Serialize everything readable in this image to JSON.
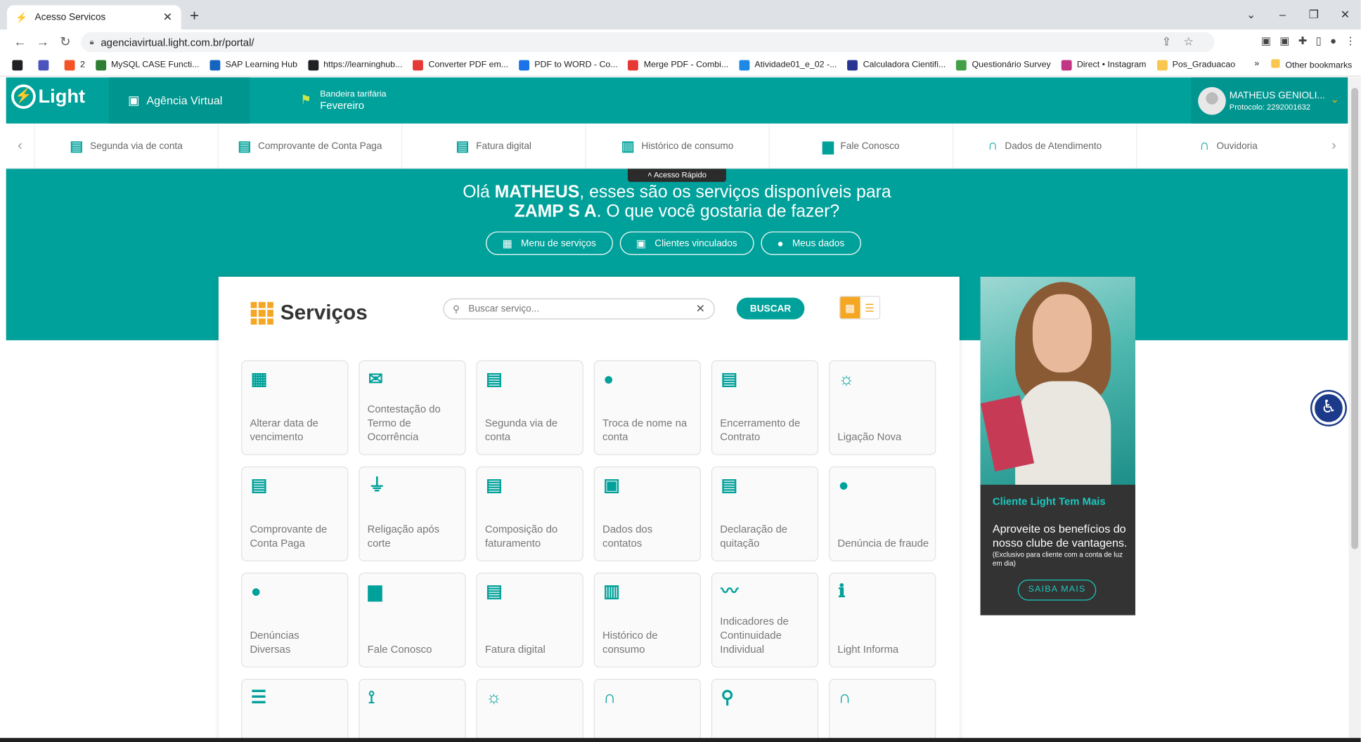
{
  "browser": {
    "tab_title": "Acesso Servicos",
    "url": "agenciavirtual.light.com.br/portal/",
    "bookmarks": [
      {
        "label": "",
        "color": "#202124"
      },
      {
        "label": "",
        "color": "#4b53bc"
      },
      {
        "label": "2",
        "color": "#f35325"
      },
      {
        "label": "MySQL CASE Functi...",
        "color": "#2e7d32"
      },
      {
        "label": "SAP Learning Hub",
        "color": "#1565c0"
      },
      {
        "label": "https://learninghub...",
        "color": "#202124"
      },
      {
        "label": "Converter PDF em...",
        "color": "#e53935"
      },
      {
        "label": "PDF to WORD - Co...",
        "color": "#1a73e8"
      },
      {
        "label": "Merge PDF - Combi...",
        "color": "#e53935"
      },
      {
        "label": "Atividade01_e_02 -...",
        "color": "#1e88e5"
      },
      {
        "label": "Calculadora Cientifi...",
        "color": "#283593"
      },
      {
        "label": "Questionário Survey",
        "color": "#43a047"
      },
      {
        "label": "Direct • Instagram",
        "color": "#c13584"
      },
      {
        "label": "Pos_Graduacao",
        "color": "#f9c74f"
      }
    ],
    "more_bookmarks": "»",
    "other_bookmarks": "Other bookmarks"
  },
  "header": {
    "logo": "Light",
    "agencia": "Agência Virtual",
    "bandeira_label": "Bandeira tarifária",
    "bandeira_value": "Fevereiro",
    "user_name": "MATHEUS GENIOLI...",
    "user_protocol": "Protocolo: 2292001632"
  },
  "quick": {
    "items": [
      {
        "icon": "bill-icon",
        "glyph": "▤",
        "label": "Segunda via de conta"
      },
      {
        "icon": "receipt-icon",
        "glyph": "▤",
        "label": "Comprovante de Conta Paga"
      },
      {
        "icon": "digital-bill-icon",
        "glyph": "▤",
        "label": "Fatura digital"
      },
      {
        "icon": "chart-icon",
        "glyph": "▥",
        "label": "Histórico de consumo"
      },
      {
        "icon": "chat-icon",
        "glyph": "▆",
        "label": "Fale Conosco"
      },
      {
        "icon": "headset-icon",
        "glyph": "∩",
        "label": "Dados de Atendimento"
      },
      {
        "icon": "headset-icon",
        "glyph": "∩",
        "label": "Ouvidoria"
      }
    ],
    "acesso_rapido": "Acesso Rápido"
  },
  "hero": {
    "pre": "Olá ",
    "name": "MATHEUS",
    "mid": ", esses são os serviços disponíveis para",
    "company": "ZAMP S A",
    "post": ". O que você gostaria de fazer?",
    "pills": [
      "Menu de serviços",
      "Clientes vinculados",
      "Meus dados"
    ]
  },
  "services": {
    "title": "Serviços",
    "search_placeholder": "Buscar serviço...",
    "search_button": "BUSCAR",
    "tiles": [
      {
        "icon": "calendar-money-icon",
        "glyph": "▦",
        "label": "Alterar data de vencimento"
      },
      {
        "icon": "envelope-icon",
        "glyph": "✉",
        "label": "Contestação do Termo de Ocorrência"
      },
      {
        "icon": "bill-icon",
        "glyph": "▤",
        "label": "Segunda via de conta"
      },
      {
        "icon": "people-icon",
        "glyph": "●",
        "label": "Troca de nome na conta"
      },
      {
        "icon": "cancel-doc-icon",
        "glyph": "▤",
        "label": "Encerramento de Contrato"
      },
      {
        "icon": "bulb-icon",
        "glyph": "☼",
        "label": "Ligação Nova"
      },
      {
        "icon": "receipt-icon",
        "glyph": "▤",
        "label": "Comprovante de Conta Paga"
      },
      {
        "icon": "plug-icon",
        "glyph": "⏚",
        "label": "Religação após corte"
      },
      {
        "icon": "search-doc-icon",
        "glyph": "▤",
        "label": "Composição do faturamento"
      },
      {
        "icon": "contact-card-icon",
        "glyph": "▣",
        "label": "Dados dos contatos"
      },
      {
        "icon": "ok-doc-icon",
        "glyph": "▤",
        "label": "Declaração de quitação"
      },
      {
        "icon": "speak-icon",
        "glyph": "●",
        "label": "Denúncia de fraude"
      },
      {
        "icon": "speak-icon",
        "glyph": "●",
        "label": "Denúncias Diversas"
      },
      {
        "icon": "chat-icon",
        "glyph": "▆",
        "label": "Fale Conosco"
      },
      {
        "icon": "digital-bill-icon",
        "glyph": "▤",
        "label": "Fatura digital"
      },
      {
        "icon": "chart-icon",
        "glyph": "▥",
        "label": "Histórico de consumo"
      },
      {
        "icon": "trend-icon",
        "glyph": "〰",
        "label": "Indicadores de Continuidade Individual"
      },
      {
        "icon": "info-icon",
        "glyph": "ℹ",
        "label": "Light Informa"
      },
      {
        "icon": "list-icon",
        "glyph": "☰",
        "label": ""
      },
      {
        "icon": "network-icon",
        "glyph": "⟟",
        "label": ""
      },
      {
        "icon": "bulb-icon",
        "glyph": "☼",
        "label": ""
      },
      {
        "icon": "headset-icon",
        "glyph": "∩",
        "label": ""
      },
      {
        "icon": "magnifier-icon",
        "glyph": "⚲",
        "label": ""
      },
      {
        "icon": "headset-icon",
        "glyph": "∩",
        "label": ""
      }
    ]
  },
  "promo": {
    "title": "Cliente Light Tem Mais",
    "desc": "Aproveite os benefícios do nosso clube de vantagens.",
    "small": "(Exclusivo para cliente com a conta de luz em dia)",
    "button": "SAIBA MAIS"
  },
  "colors": {
    "brand": "#00a19a",
    "accent": "#f5a623"
  }
}
